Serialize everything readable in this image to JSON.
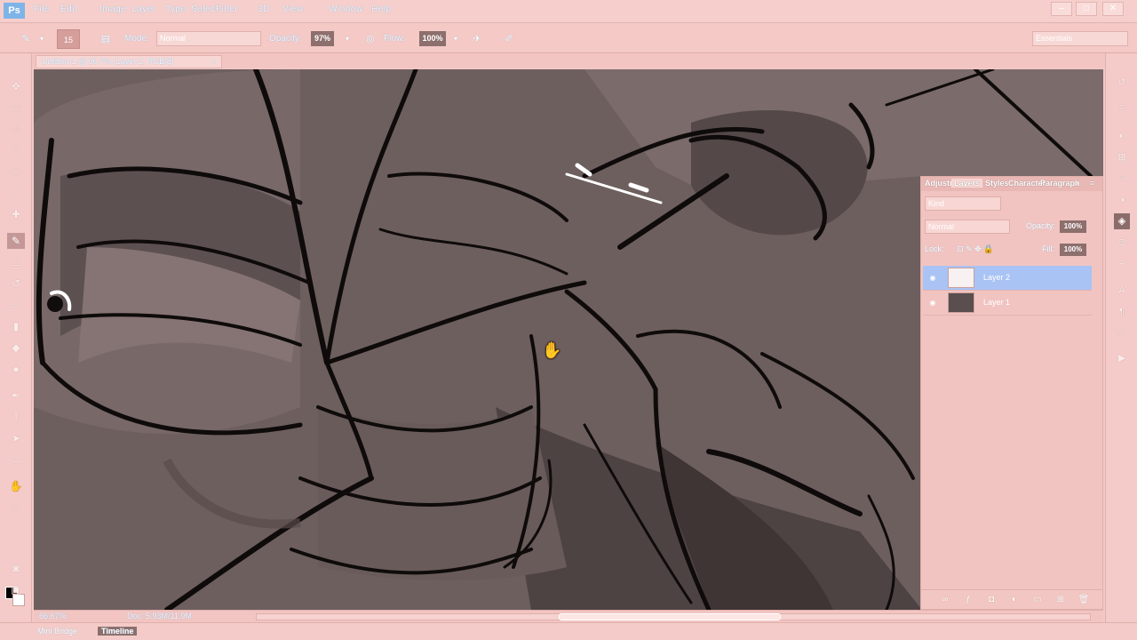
{
  "app": {
    "logo": "Ps"
  },
  "menubar": {
    "items": [
      "File",
      "Edit",
      "Image",
      "Layer",
      "Type",
      "Select",
      "Filter",
      "3D",
      "View",
      "Window",
      "Help"
    ],
    "window_controls": [
      "–",
      "□",
      "✕"
    ]
  },
  "options": {
    "brush_size": "15",
    "mode_label": "Mode:",
    "mode_value": "Normal",
    "opacity_label": "Opacity:",
    "opacity_value": "97%",
    "flow_label": "Flow:",
    "flow_value": "100%",
    "workspace": "Essentials"
  },
  "document": {
    "tab_title": "Untitled-1 @ 66.7% (Layer 2, RGB/8)",
    "tab_close": "×"
  },
  "status": {
    "zoom": "66.67%",
    "doc_info": "Doc: 5.93M/11.9M"
  },
  "bottom": {
    "tabs": [
      "Mini Bridge",
      "Timeline"
    ]
  },
  "layers_panel": {
    "tabs": [
      "Adjustments",
      "Layers",
      "Styles",
      "Character",
      "Paragraph"
    ],
    "filter_label": "Kind",
    "blend_mode": "Normal",
    "opacity_label": "Opacity:",
    "opacity_value": "100%",
    "fill_label": "Fill:",
    "fill_value": "100%",
    "lock_label": "Lock:",
    "layers": [
      {
        "name": "Layer 2",
        "selected": true,
        "thumb_color": "#f7f1f1"
      },
      {
        "name": "Layer 1",
        "selected": false,
        "thumb_color": "#5a4e4e"
      }
    ]
  },
  "colors": {
    "foreground": "#000000",
    "background": "#ffffff",
    "canvas_tone": "#6d5e5e",
    "selection": "#a9c3f5"
  }
}
